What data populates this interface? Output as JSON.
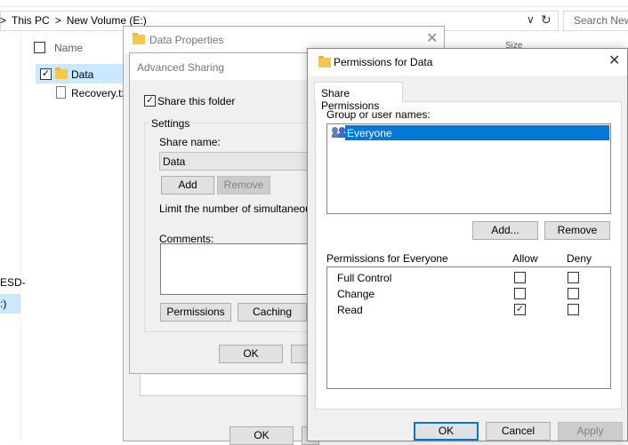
{
  "explorer": {
    "breadcrumb": [
      ">",
      "This PC",
      ">",
      "New Volume (E:)"
    ],
    "search_placeholder": "Search New",
    "column_name": "Name",
    "column_size": "Size",
    "files": [
      {
        "name": "Data",
        "selected": true
      },
      {
        "name": "Recovery.tx",
        "selected": false
      }
    ],
    "nav_items": [
      "ESD-",
      ":)"
    ]
  },
  "data_properties": {
    "title": "Data Properties",
    "ok_label": "OK"
  },
  "advanced_sharing": {
    "title": "Advanced Sharing",
    "share_checkbox_label": "Share this folder",
    "share_checked": true,
    "settings_label": "Settings",
    "share_name_label": "Share name:",
    "share_name_value": "Data",
    "add_label": "Add",
    "remove_label": "Remove",
    "limit_label": "Limit the number of simultaneous us",
    "comments_label": "Comments:",
    "permissions_label": "Permissions",
    "caching_label": "Caching",
    "ok_label": "OK"
  },
  "permissions": {
    "title": "Permissions for Data",
    "tab_label": "Share Permissions",
    "group_label": "Group or user names:",
    "users": [
      "Everyone"
    ],
    "add_label": "Add...",
    "remove_label": "Remove",
    "perm_header": "Permissions for Everyone",
    "allow_header": "Allow",
    "deny_header": "Deny",
    "rows": [
      {
        "name": "Full Control",
        "allow": false,
        "deny": false
      },
      {
        "name": "Change",
        "allow": false,
        "deny": false
      },
      {
        "name": "Read",
        "allow": true,
        "deny": false
      }
    ],
    "ok_label": "OK",
    "cancel_label": "Cancel",
    "apply_label": "Apply"
  },
  "colors": {
    "selection": "#0078d7",
    "highlight": "#cce8ff"
  }
}
